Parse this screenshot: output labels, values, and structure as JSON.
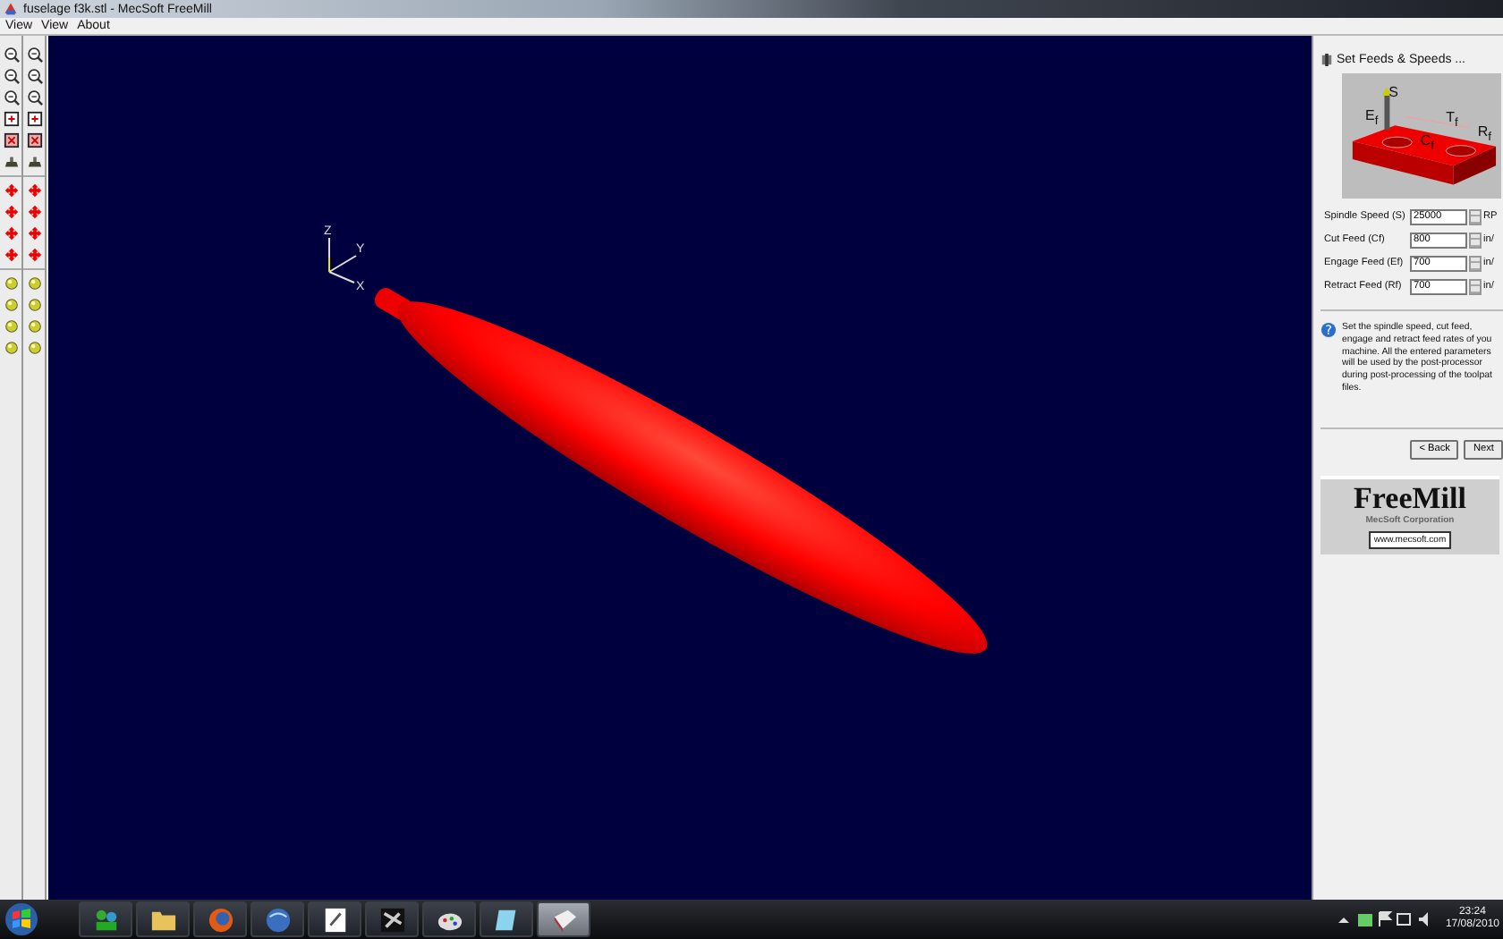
{
  "window": {
    "title": "fuselage f3k.stl - MecSoft  FreeMill"
  },
  "menu": [
    {
      "label": "View"
    },
    {
      "label": "View"
    },
    {
      "label": "About"
    }
  ],
  "viewport": {
    "axes": {
      "z": "Z",
      "y": "Y",
      "x": "X"
    }
  },
  "wizard": {
    "title": "Set Feeds & Speeds ...",
    "diagram_labels": [
      {
        "kind": "e",
        "text": "E$_{f}$"
      },
      {
        "kind": "s",
        "text": "S"
      },
      {
        "kind": "t",
        "text": "T$_{f}$"
      },
      {
        "kind": "r",
        "text": "R$_{f}$"
      },
      {
        "kind": "c",
        "text": "C$_{f}$"
      }
    ],
    "fields": [
      {
        "label": "Spindle Speed (S)",
        "value": "25000",
        "unit": "RP"
      },
      {
        "label": "Cut Feed (Cf)",
        "value": "800",
        "unit": "in/"
      },
      {
        "label": "Engage Feed (Ef)",
        "value": "700",
        "unit": "in/"
      },
      {
        "label": "Retract Feed (Rf)",
        "value": "700",
        "unit": "in/"
      }
    ],
    "help_icon": "?",
    "help": "Set the spindle speed, cut feed, engage and retract feed rates of you machine.  All the entered parameters will be used by the post-processor during post-processing of the toolpat files.",
    "buttons": [
      {
        "label": "< Back"
      },
      {
        "label": "Next"
      }
    ]
  },
  "logo": {
    "name": "FreeMill",
    "company": "MecSoft Corporation",
    "url": "www.mecsoft.com"
  },
  "taskbar": {
    "time": "23:24",
    "date": "17/08/2010"
  }
}
